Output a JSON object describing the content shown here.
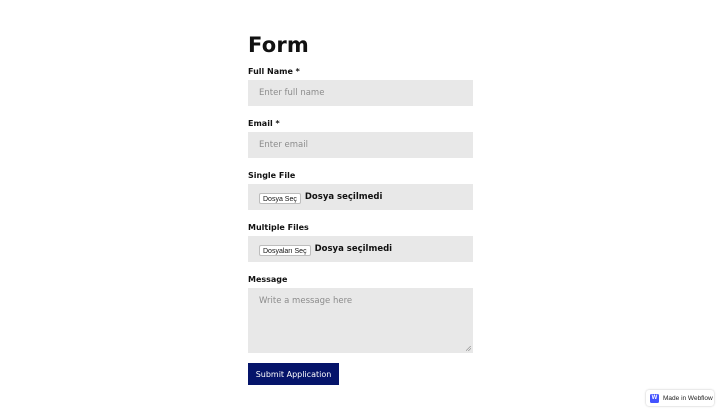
{
  "form": {
    "title": "Form",
    "full_name": {
      "label": "Full Name *",
      "placeholder": "Enter full name",
      "value": ""
    },
    "email": {
      "label": "Email *",
      "placeholder": "Enter email",
      "value": ""
    },
    "single_file": {
      "label": "Single File",
      "button_label": "Dosya Seç",
      "status": "Dosya seçilmedi"
    },
    "multiple_files": {
      "label": "Multiple Files",
      "button_label": "Dosyaları Seç",
      "status": "Dosya seçilmedi"
    },
    "message": {
      "label": "Message",
      "placeholder": "Write a message here",
      "value": ""
    },
    "submit_label": "Submit Application"
  },
  "badge": {
    "logo_letter": "W",
    "text": "Made in Webflow",
    "icon": "webflow-logo-icon"
  },
  "colors": {
    "input_bg": "#e8e8e8",
    "submit_bg": "#05146a",
    "webflow_brand": "#4353ff"
  }
}
